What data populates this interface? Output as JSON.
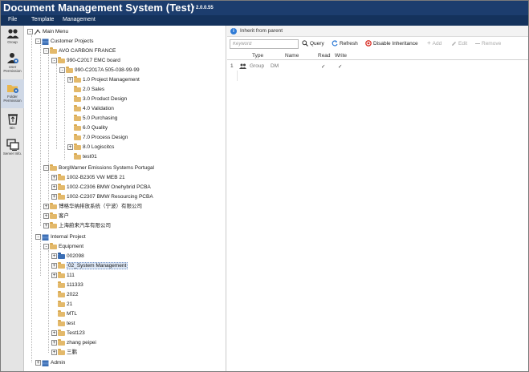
{
  "app": {
    "title": "Document Management System (Test)",
    "version": "v 2.0.0.55"
  },
  "menu": [
    "File",
    "Template",
    "Management"
  ],
  "rail": [
    {
      "label": "Group",
      "icon": "group-icon"
    },
    {
      "label": "User Permission",
      "icon": "user-permission-icon"
    },
    {
      "label": "Folder Permission",
      "icon": "folder-permission-icon",
      "active": true
    },
    {
      "label": "Bin",
      "icon": "bin-icon"
    },
    {
      "label": "Server Info.",
      "icon": "server-info-icon"
    }
  ],
  "tree": {
    "nodes": [
      {
        "label": "Main Menu",
        "icon": "main-menu-icon"
      },
      {
        "label": "Customer Projects",
        "icon": "database-icon"
      },
      {
        "label": "AVO CARBON FRANCE"
      },
      {
        "label": "990-C2017  EMC board"
      },
      {
        "label": "990-C2017A  505-038-99-99"
      },
      {
        "label": "1.0 Project Management"
      },
      {
        "label": "2.0 Sales"
      },
      {
        "label": "3.0 Product Design"
      },
      {
        "label": "4.0 Validation"
      },
      {
        "label": "5.0 Purchasing"
      },
      {
        "label": "6.0 Quality"
      },
      {
        "label": "7.0 Process Design"
      },
      {
        "label": "8.0 Logiscitcs"
      },
      {
        "label": "test01"
      },
      {
        "label": "BorgWarner Emissions Systems Portugal"
      },
      {
        "label": "1002-B2305  VW MEB 21"
      },
      {
        "label": "1002-C2306  BMW Onehybrid PCBA"
      },
      {
        "label": "1002-C2307  BMW Resourcing PCBA"
      },
      {
        "label": "博格华纳排放系统（宁波）有限公司"
      },
      {
        "label": "客户"
      },
      {
        "label": "上海蔚来汽车有限公司"
      },
      {
        "label": "Internal Project",
        "icon": "database-icon"
      },
      {
        "label": "Equipment"
      },
      {
        "label": "002098"
      },
      {
        "label": "02_System Management",
        "selected": true
      },
      {
        "label": "111"
      },
      {
        "label": "111333"
      },
      {
        "label": "2022"
      },
      {
        "label": "21"
      },
      {
        "label": "MTL"
      },
      {
        "label": "test"
      },
      {
        "label": "Test123"
      },
      {
        "label": "zhang peipei"
      },
      {
        "label": "三鹏"
      },
      {
        "label": "Admin",
        "icon": "database-icon"
      }
    ]
  },
  "permissions": {
    "inherit_label": "Inherit from parent",
    "keyword_placeholder": "Keyword",
    "buttons": {
      "query": "Query",
      "refresh": "Refresh",
      "disable_inheritance": "Disable Inheritance",
      "add": "Add",
      "edit": "Edit",
      "remove": "Remove"
    },
    "columns": [
      "Type",
      "Name",
      "Read",
      "Write"
    ],
    "rows": [
      {
        "num": "1",
        "type": "Group",
        "name": "DM",
        "read": "✓",
        "write": "✓"
      }
    ]
  },
  "colors": {
    "titlebar": "#1c3d6e",
    "menubar": "#14325c",
    "folder": "#e3b96b",
    "selection": "#dce6f4",
    "disable_red": "#d9342b",
    "refresh_blue": "#2f7bd6"
  }
}
